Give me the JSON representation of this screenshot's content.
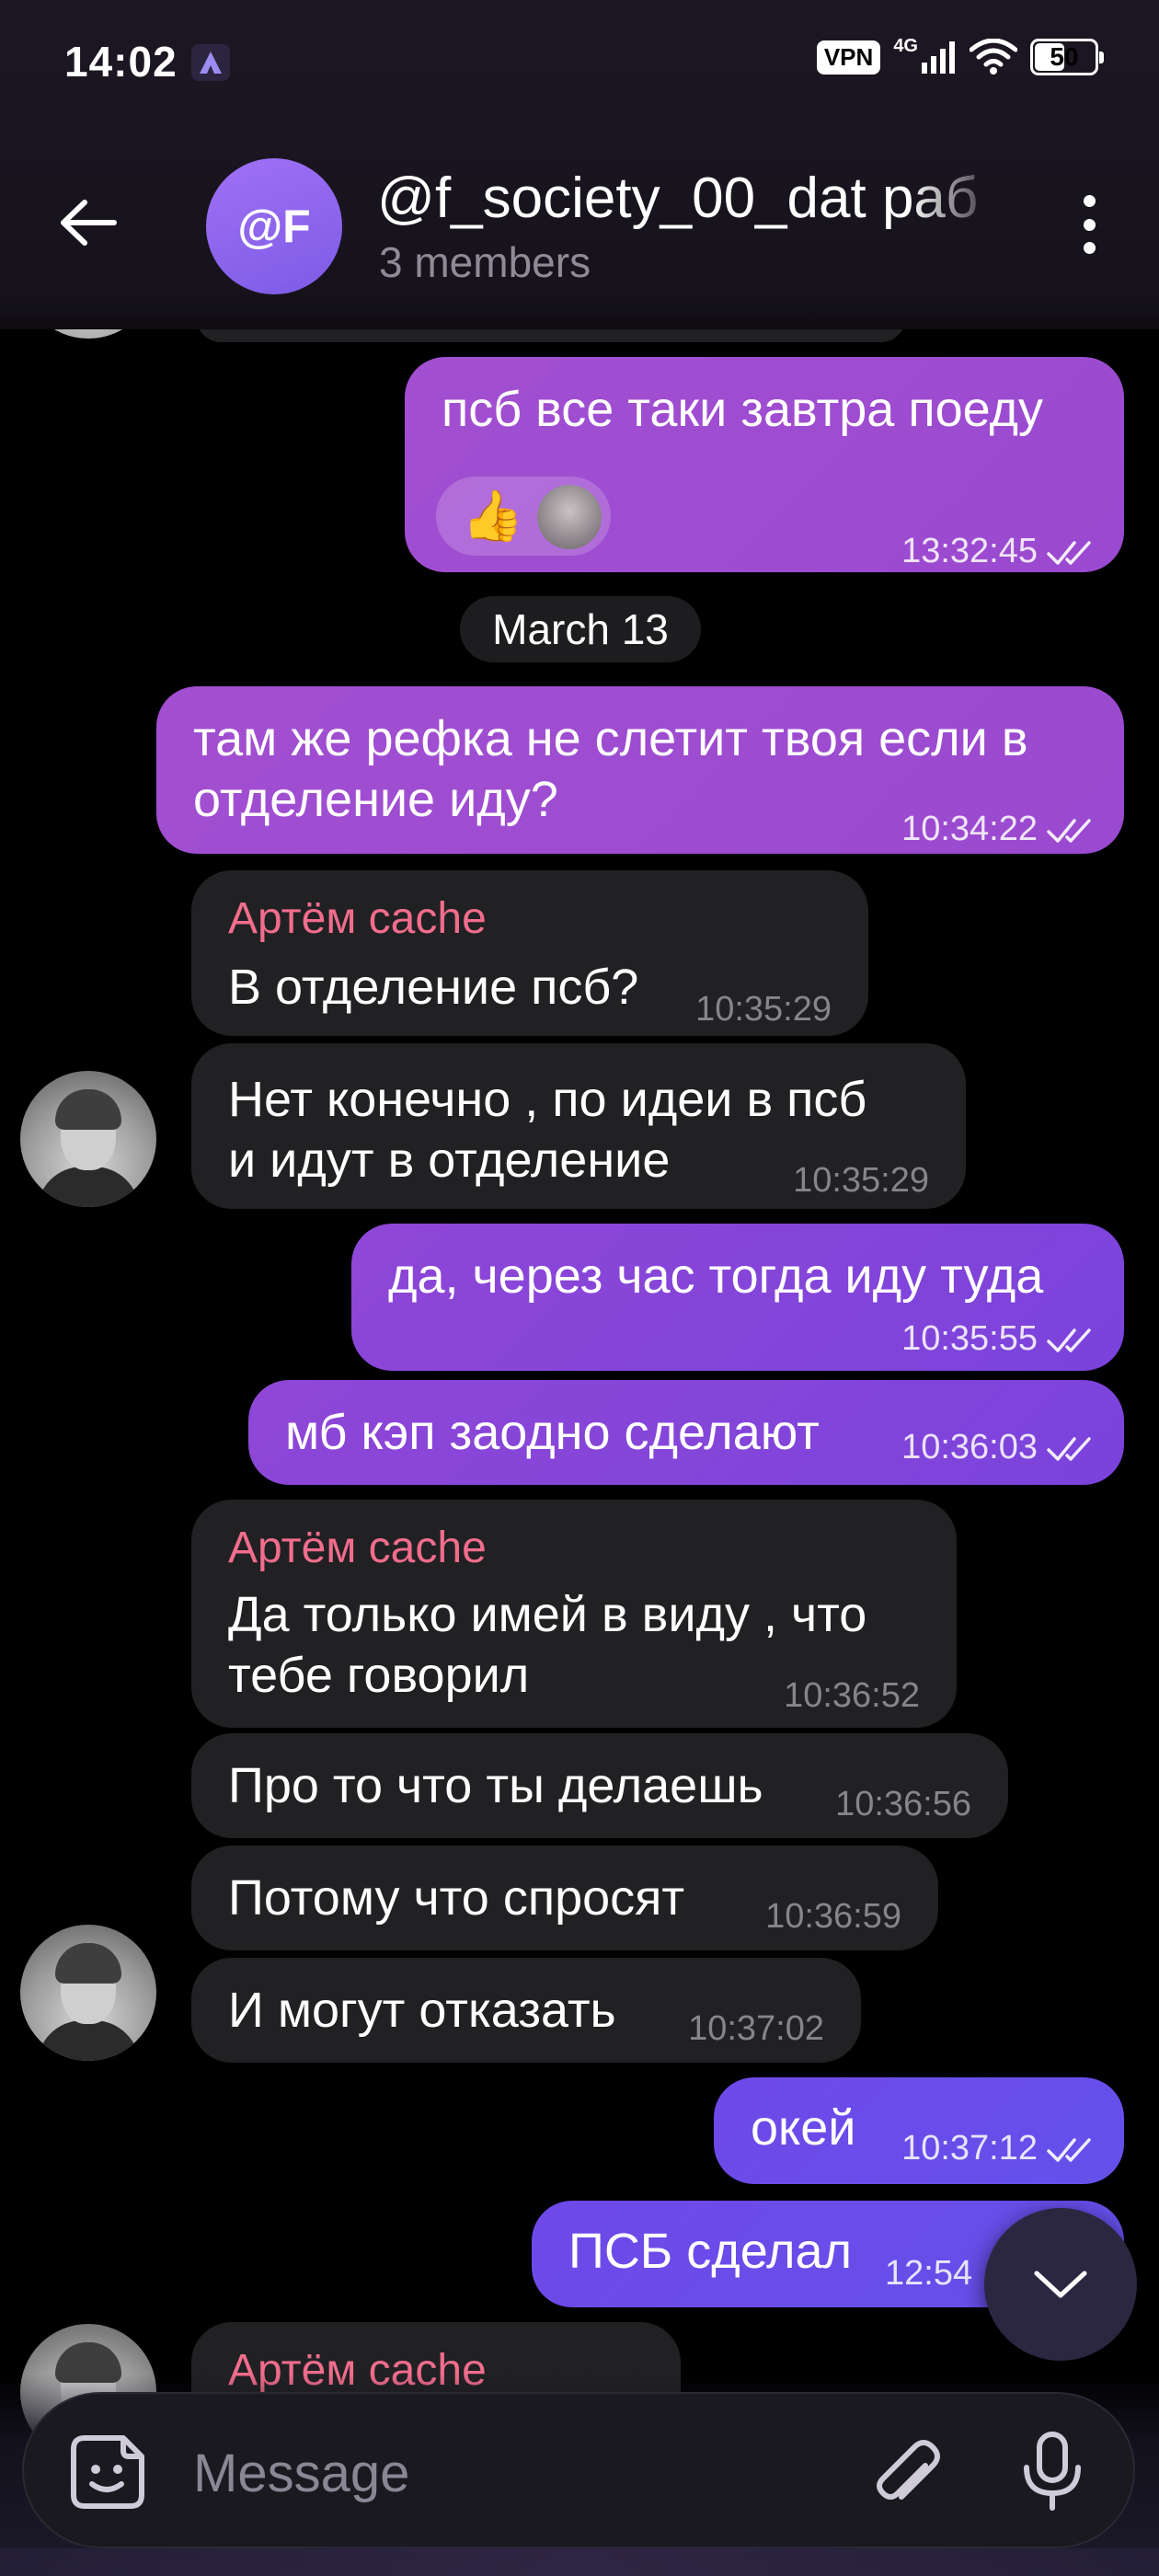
{
  "status_bar": {
    "time": "14:02",
    "vpn": "VPN",
    "network": "4G",
    "battery_level": "50",
    "battery_fraction": 0.5
  },
  "header": {
    "avatar_initials": "@F",
    "title": "@f_society_00_dat раб",
    "subtitle": "3 members"
  },
  "date_separator": "March 13",
  "messages": [
    {
      "dir": "out",
      "text": "псб все таки завтра поеду",
      "time": "13:32:45",
      "read": true,
      "reaction": "👍"
    },
    {
      "dir": "out",
      "lines": [
        "там же рефка не слетит твоя если в",
        "отделение иду?"
      ],
      "time": "10:34:22",
      "read": true
    },
    {
      "dir": "in",
      "sender": "Артём cache",
      "text": "В отделение псб?",
      "time": "10:35:29"
    },
    {
      "dir": "in",
      "lines": [
        "Нет конечно , по идеи в псб",
        "и идут в отделение"
      ],
      "time": "10:35:29"
    },
    {
      "dir": "out",
      "text": "да, через час тогда иду туда",
      "time": "10:35:55",
      "read": true
    },
    {
      "dir": "out",
      "text": "мб кэп заодно сделают",
      "time": "10:36:03",
      "read": true
    },
    {
      "dir": "in",
      "sender": "Артём cache",
      "lines": [
        "Да только имей в виду , что",
        "тебе говорил"
      ],
      "time": "10:36:52"
    },
    {
      "dir": "in",
      "text": "Про то что ты делаешь",
      "time": "10:36:56"
    },
    {
      "dir": "in",
      "text": "Потому что спросят",
      "time": "10:36:59"
    },
    {
      "dir": "in",
      "text": "И могут отказать",
      "time": "10:37:02"
    },
    {
      "dir": "out",
      "text": "окей",
      "time": "10:37:12",
      "read": true
    },
    {
      "dir": "out",
      "text": "ПСБ сделал",
      "time": "12:54"
    },
    {
      "dir": "in",
      "sender": "Артём cache"
    }
  ],
  "composer": {
    "placeholder": "Message"
  },
  "icons": {
    "back": "arrow-left-icon",
    "menu": "more-vertical-icon",
    "sticker": "sticker-icon",
    "attach": "paperclip-icon",
    "mic": "microphone-icon",
    "scroll_down": "chevron-down-icon",
    "read": "double-check-icon"
  },
  "colors": {
    "outgoing_bubble": "#9d4dd0",
    "incoming_bubble": "#212023",
    "sender_name": "#f16d8c",
    "avatar_group": "#8f66ee"
  }
}
